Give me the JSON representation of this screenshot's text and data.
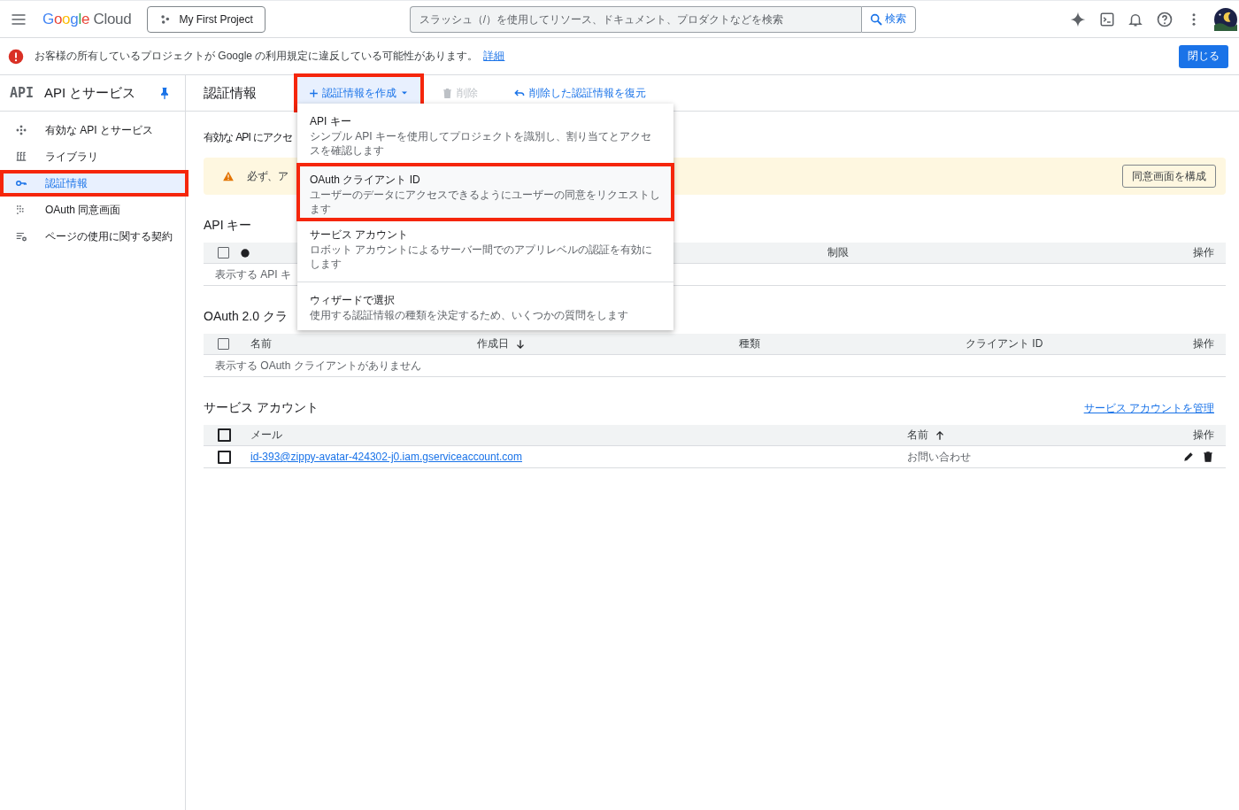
{
  "topbar": {
    "product": "Google Cloud",
    "project": "My First Project",
    "search": {
      "placeholder": "スラッシュ（/）を使用してリソース、ドキュメント、プロダクトなどを検索",
      "button": "検索"
    }
  },
  "banner": {
    "message": "お客様の所有しているプロジェクトが Google の利用規定に違反している可能性があります。",
    "link": "詳細",
    "button": "閉じる"
  },
  "sidebar": {
    "badge": "API",
    "title": "API とサービス",
    "items": [
      {
        "label": "有効な API とサービス",
        "selected": false,
        "highlighted": false
      },
      {
        "label": "ライブラリ",
        "selected": false,
        "highlighted": false
      },
      {
        "label": "認証情報",
        "selected": true,
        "highlighted": true
      },
      {
        "label": "OAuth 同意画面",
        "selected": false,
        "highlighted": false
      },
      {
        "label": "ページの使用に関する契約",
        "selected": false,
        "highlighted": false
      }
    ]
  },
  "toolbar": {
    "title": "認証情報",
    "create": {
      "label": "認証情報を作成",
      "highlighted": true
    },
    "delete": {
      "label": "削除",
      "disabled": true
    },
    "restore": "削除した認証情報を復元"
  },
  "intro": "有効な API にアクセ",
  "notice": {
    "text": "必ず、ア",
    "button": "同意画面を構成"
  },
  "sections": [
    {
      "kind": "api",
      "title": "API キー",
      "checked": false,
      "columns": [
        {
          "kind": "dot"
        },
        {
          "label": "制限"
        },
        {
          "label": "操作"
        }
      ],
      "empty": "表示する API キ"
    },
    {
      "kind": "oauth",
      "title": "OAuth 2.0 クラ",
      "checked": false,
      "columns": [
        {
          "label": "名前"
        },
        {
          "label": "作成日",
          "kind": "sorted-desc"
        },
        {
          "label": "種類"
        },
        {
          "label": "クライアント ID"
        },
        {
          "label": "操作"
        }
      ],
      "empty": "表示する OAuth クライアントがありません"
    },
    {
      "kind": "service",
      "title": "サービス アカウント",
      "link": "サービス アカウントを管理",
      "checked": false,
      "columns": [
        {
          "label": "メール"
        },
        {
          "label": "名前",
          "kind": "sorted-asc"
        },
        {
          "label": "操作"
        }
      ],
      "rows": [
        {
          "checked": false,
          "email": "id-393@zippy-avatar-424302-j0.iam.gserviceaccount.com",
          "name": "お問い合わせ"
        }
      ]
    }
  ],
  "menu": {
    "items": [
      {
        "title": "API キー",
        "description": "シンプル API キーを使用してプロジェクトを識別し、割り当てとアクセスを確認します",
        "highlighted": false
      },
      {
        "title": "OAuth クライアント ID",
        "description": "ユーザーのデータにアクセスできるようにユーザーの同意をリクエストします",
        "highlighted": true
      },
      {
        "title": "サービス アカウント",
        "description": "ロボット アカウントによるサーバー間でのアプリレベルの認証を有効にします",
        "highlighted": false
      },
      {
        "title": "ウィザードで選択",
        "description": "使用する認証情報の種類を決定するため、いくつかの質問をします",
        "highlighted": false
      }
    ]
  }
}
